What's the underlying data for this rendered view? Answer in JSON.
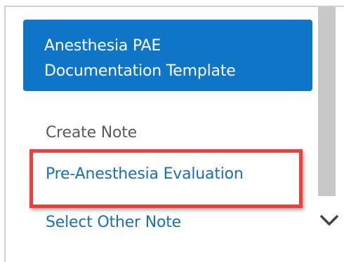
{
  "template_button": {
    "line1": "Anesthesia PAE",
    "line2": "Documentation Template"
  },
  "menu": {
    "create_note": "Create Note",
    "pre_anesthesia": "Pre-Anesthesia Evaluation",
    "select_other": "Select Other Note"
  },
  "icons": {
    "scroll_down": "chevron-down-icon"
  },
  "colors": {
    "button_bg": "#0f75c6",
    "link": "#1a6fb7",
    "highlight": "#e8413e",
    "label": "#5a5a5a"
  }
}
